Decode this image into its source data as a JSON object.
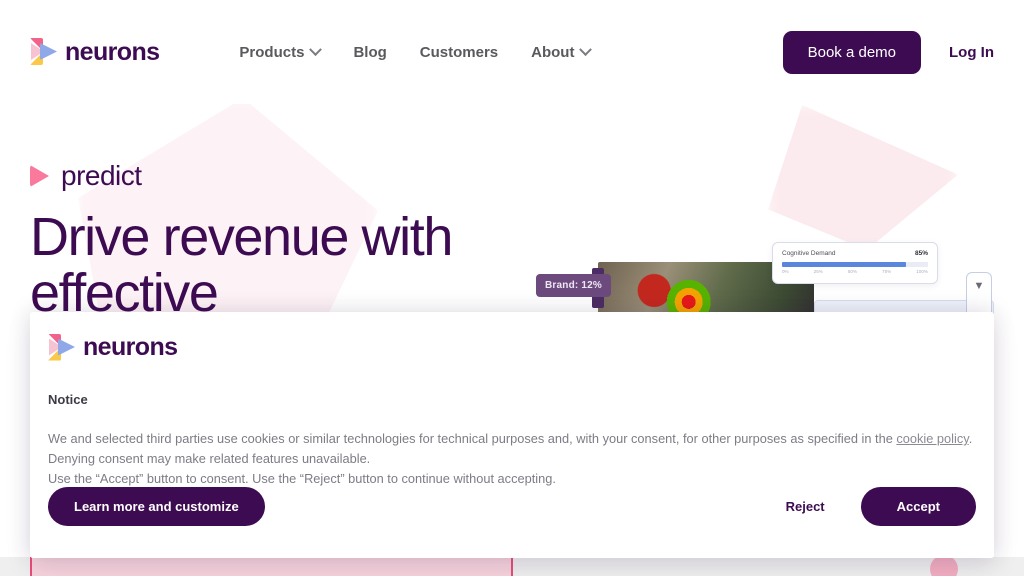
{
  "brand": {
    "name": "neurons",
    "logo_icon": "neurons-play-logo",
    "colors": {
      "purple": "#3D0B52",
      "pink": "#FA7A9E",
      "blue": "#5B86DD"
    }
  },
  "header": {
    "nav": [
      {
        "label": "Products",
        "has_dropdown": true,
        "icon": "chevron-down-icon"
      },
      {
        "label": "Blog",
        "has_dropdown": false
      },
      {
        "label": "Customers",
        "has_dropdown": false
      },
      {
        "label": "About",
        "has_dropdown": true,
        "icon": "chevron-down-icon"
      }
    ],
    "cta_label": "Book a demo",
    "login_label": "Log In"
  },
  "hero": {
    "eyebrow": "predict",
    "eyebrow_icon": "play-triangle-icon",
    "headline": "Drive revenue with effective"
  },
  "product_preview": {
    "brand_badge": "Brand: 12%",
    "cognitive_card": {
      "label": "Cognitive Demand",
      "value": "85%",
      "fill_percent": 85,
      "ticks": [
        "0%",
        "25%",
        "50%",
        "75%",
        "100%"
      ]
    },
    "cursor_icon": "cursor-pointer-icon"
  },
  "cookie_banner": {
    "logo_icon": "neurons-play-logo",
    "logo_word": "neurons",
    "title": "Notice",
    "body_part1": "We and selected third parties use cookies or similar technologies for technical purposes and, with your consent, for other purposes as specified in the ",
    "link_text": "cookie policy",
    "body_part2": ". Denying consent may make related features unavailable.",
    "body_line3": "Use the “Accept” button to consent. Use the “Reject” button to continue without accepting.",
    "learn_more_label": "Learn more and customize",
    "reject_label": "Reject",
    "accept_label": "Accept"
  }
}
